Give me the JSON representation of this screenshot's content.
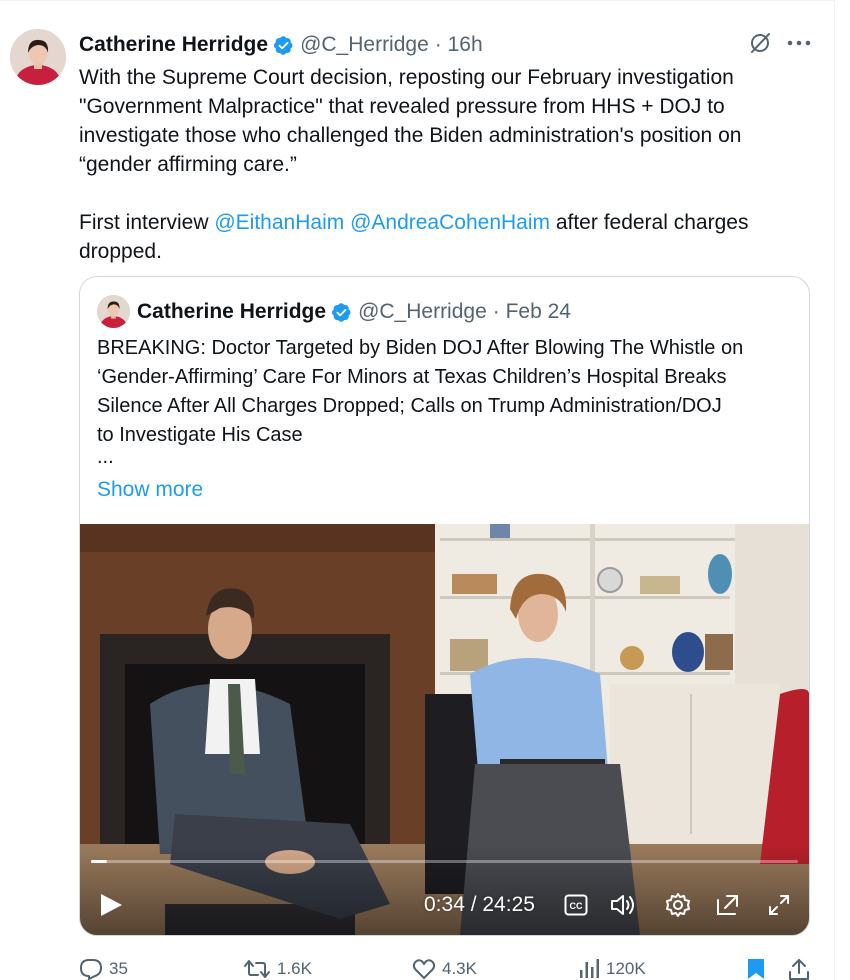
{
  "author": {
    "name": "Catherine Herridge",
    "handle": "@C_Herridge",
    "time": "· 16h"
  },
  "tweet": {
    "lines": [
      "With the Supreme Court decision, reposting our February investigation",
      "\"Government Malpractice\" that revealed pressure from HHS + DOJ to",
      "investigate those who challenged the Biden administration's position on",
      "“gender affirming care.”"
    ],
    "line5_prefix": "First interview ",
    "mention1": "@EithanHaim",
    "mention2": "@AndreaCohenHaim",
    "line5_suffix": " after federal charges",
    "line6": "dropped."
  },
  "quote": {
    "name": "Catherine Herridge",
    "handle": "@C_Herridge",
    "time": "· Feb 24",
    "lines": [
      "BREAKING: Doctor Targeted by Biden DOJ After Blowing The Whistle on",
      "‘Gender-Affirming’ Care For Minors at Texas Children’s Hospital Breaks",
      "Silence After All Charges Dropped; Calls on Trump Administration/DOJ",
      "to Investigate His Case"
    ],
    "ellipsis": "...",
    "show_more": "Show more"
  },
  "video": {
    "time_display": "0:34 / 24:25",
    "progress": 0.023
  },
  "actions": {
    "replies": "35",
    "reposts": "1.6K",
    "likes": "4.3K",
    "views": "120K"
  },
  "colors": {
    "accent": "#1d9bf0",
    "text": "#0f1419",
    "muted": "#536471"
  },
  "icons": [
    "verified-badge-icon",
    "grok-icon",
    "more-icon",
    "play-icon",
    "captions-icon",
    "volume-icon",
    "settings-icon",
    "pip-icon",
    "fullscreen-icon",
    "reply-icon",
    "repost-icon",
    "like-icon",
    "views-icon",
    "bookmark-icon",
    "share-icon"
  ]
}
